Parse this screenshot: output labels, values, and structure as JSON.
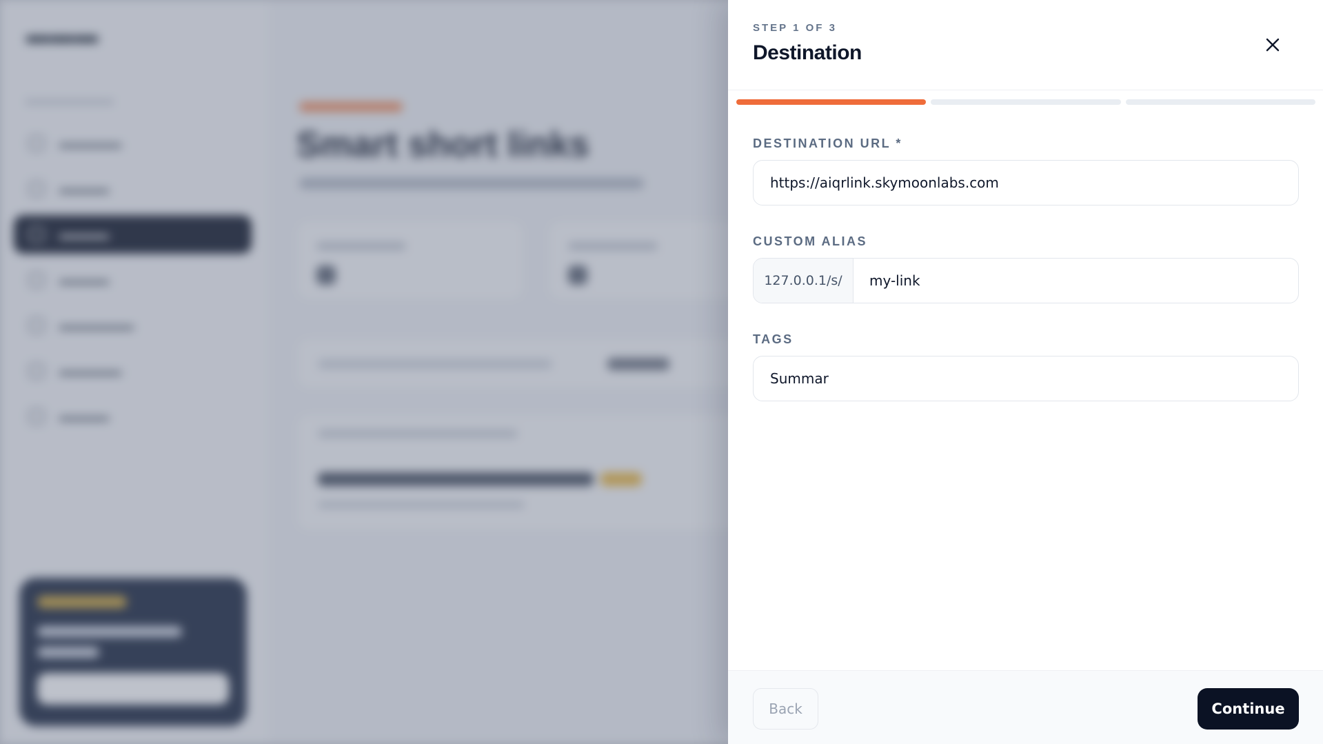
{
  "drawer": {
    "step_label": "STEP 1 OF 3",
    "title": "Destination",
    "close_icon": "close-icon",
    "progress": {
      "current_step": 1,
      "total_steps": 3,
      "accent_color": "#ef6c3a",
      "track_color": "#e9edf2"
    }
  },
  "form": {
    "destination": {
      "label": "DESTINATION URL *",
      "value": "https://aiqrlink.skymoonlabs.com"
    },
    "alias": {
      "label": "CUSTOM ALIAS",
      "prefix": "127.0.0.1/s/",
      "value": "my-link"
    },
    "tags": {
      "label": "TAGS",
      "value": "Summar"
    }
  },
  "footer": {
    "back_label": "Back",
    "continue_label": "Continue"
  },
  "background": {
    "title": "Smart short links"
  },
  "colors": {
    "primary_button": "#0b1224",
    "accent": "#ef6c3a"
  }
}
